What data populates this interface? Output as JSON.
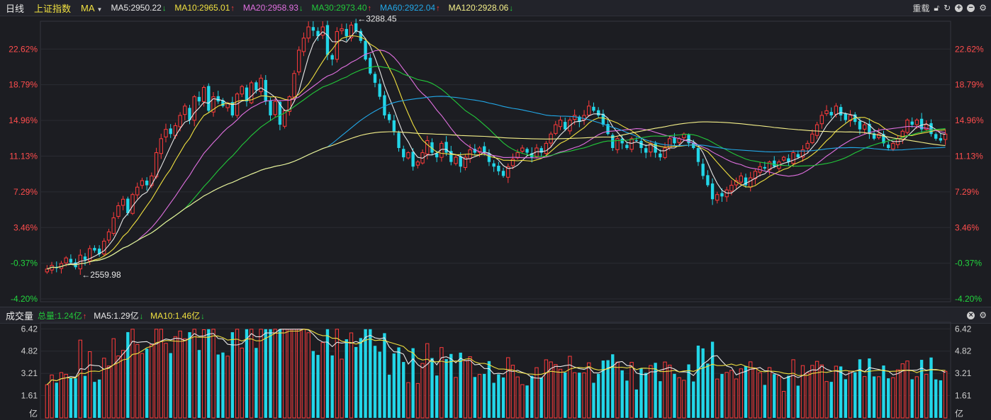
{
  "header": {
    "period": "日线",
    "index_name": "上证指数",
    "indicator": "MA",
    "restore_label": "重载",
    "ma_items": [
      {
        "text": "MA5:2950.22",
        "dir": "down",
        "color": "#e8e8e8"
      },
      {
        "text": "MA10:2965.01",
        "dir": "up",
        "color": "#f0e040"
      },
      {
        "text": "MA20:2958.93",
        "dir": "down",
        "color": "#e070e0"
      },
      {
        "text": "MA30:2973.40",
        "dir": "up",
        "color": "#22c83a"
      },
      {
        "text": "MA60:2922.04",
        "dir": "up",
        "color": "#22a8e8"
      },
      {
        "text": "MA120:2928.06",
        "dir": "down",
        "color": "#f5f08a"
      }
    ]
  },
  "volume_header": {
    "title": "成交量",
    "items": [
      {
        "text": "总量:1.24亿",
        "dir": "up",
        "color": "#22c83a"
      },
      {
        "text": "MA5:1.29亿",
        "dir": "down",
        "color": "#e8e8e8"
      },
      {
        "text": "MA10:1.46亿",
        "dir": "down",
        "color": "#f0e040"
      }
    ]
  },
  "colors": {
    "up": "#ff3b3b",
    "down": "#22d6e8",
    "axis_up": "#ff4d4d",
    "axis_down": "#22d63e",
    "grid": "#2a2c33"
  },
  "chart_data": [
    {
      "type": "candlestick",
      "title": "上证指数",
      "y_ticks_percent": [
        "22.62%",
        "18.79%",
        "14.96%",
        "11.13%",
        "7.29%",
        "3.46%",
        "-0.37%",
        "-4.20%"
      ],
      "ylim_percent": [
        -4.2,
        25.0
      ],
      "annotations": [
        {
          "label": "3288.45",
          "type": "high"
        },
        {
          "label": "2559.98",
          "type": "low"
        }
      ],
      "candles_close_percent": [
        -1.0,
        -0.6,
        -0.9,
        -0.4,
        0.2,
        -0.3,
        -0.8,
        0.5,
        0.0,
        1.2,
        1.0,
        0.6,
        2.0,
        3.0,
        4.5,
        5.8,
        6.5,
        5.0,
        7.0,
        7.8,
        8.5,
        8.0,
        9.0,
        11.5,
        13.0,
        14.0,
        13.5,
        14.4,
        15.5,
        16.5,
        15.0,
        17.5,
        17.0,
        18.5,
        16.0,
        17.5,
        17.0,
        16.5,
        16.8,
        15.5,
        17.8,
        18.6,
        17.0,
        19.0,
        18.2,
        19.5,
        17.0,
        15.5,
        17.0,
        14.5,
        16.0,
        17.5,
        20.0,
        22.5,
        23.8,
        25.0,
        24.6,
        24.0,
        25.0,
        22.0,
        21.5,
        24.5,
        24.8,
        24.0,
        25.2,
        24.5,
        23.5,
        21.5,
        20.0,
        19.0,
        17.5,
        15.5,
        15.0,
        13.8,
        12.0,
        11.0,
        11.5,
        10.0,
        10.5,
        11.5,
        12.8,
        11.5,
        11.0,
        12.5,
        11.5,
        10.5,
        11.0,
        10.0,
        11.0,
        11.8,
        11.5,
        12.0,
        11.5,
        10.5,
        10.0,
        9.5,
        9.0,
        10.0,
        10.8,
        11.5,
        12.0,
        11.5,
        11.0,
        12.0,
        11.5,
        12.5,
        13.5,
        14.5,
        15.0,
        14.0,
        15.0,
        15.5,
        14.8,
        15.5,
        16.5,
        16.0,
        15.5,
        14.5,
        13.5,
        12.0,
        13.0,
        12.5,
        12.0,
        13.0,
        12.8,
        12.0,
        11.5,
        12.5,
        11.5,
        11.0,
        12.0,
        13.0,
        12.5,
        13.0,
        13.5,
        12.5,
        12.0,
        10.5,
        9.0,
        8.0,
        6.5,
        7.0,
        6.8,
        7.5,
        8.0,
        8.5,
        9.0,
        8.0,
        8.8,
        9.5,
        10.0,
        9.8,
        10.5,
        10.0,
        10.5,
        11.0,
        10.5,
        11.5,
        11.0,
        11.8,
        12.5,
        13.5,
        14.5,
        15.5,
        16.0,
        15.5,
        16.5,
        15.5,
        15.0,
        15.5,
        14.8,
        14.0,
        14.5,
        13.5,
        13.0,
        13.5,
        12.5,
        12.0,
        12.5,
        13.0,
        13.8,
        15.0,
        14.5,
        15.0,
        14.0,
        14.5,
        13.5,
        13.0,
        12.8,
        13.5
      ]
    },
    {
      "type": "bar",
      "title": "成交量",
      "unit": "亿",
      "y_ticks": [
        "6.42",
        "4.82",
        "3.21",
        "1.61"
      ],
      "ylim": [
        0,
        6.9
      ]
    }
  ]
}
